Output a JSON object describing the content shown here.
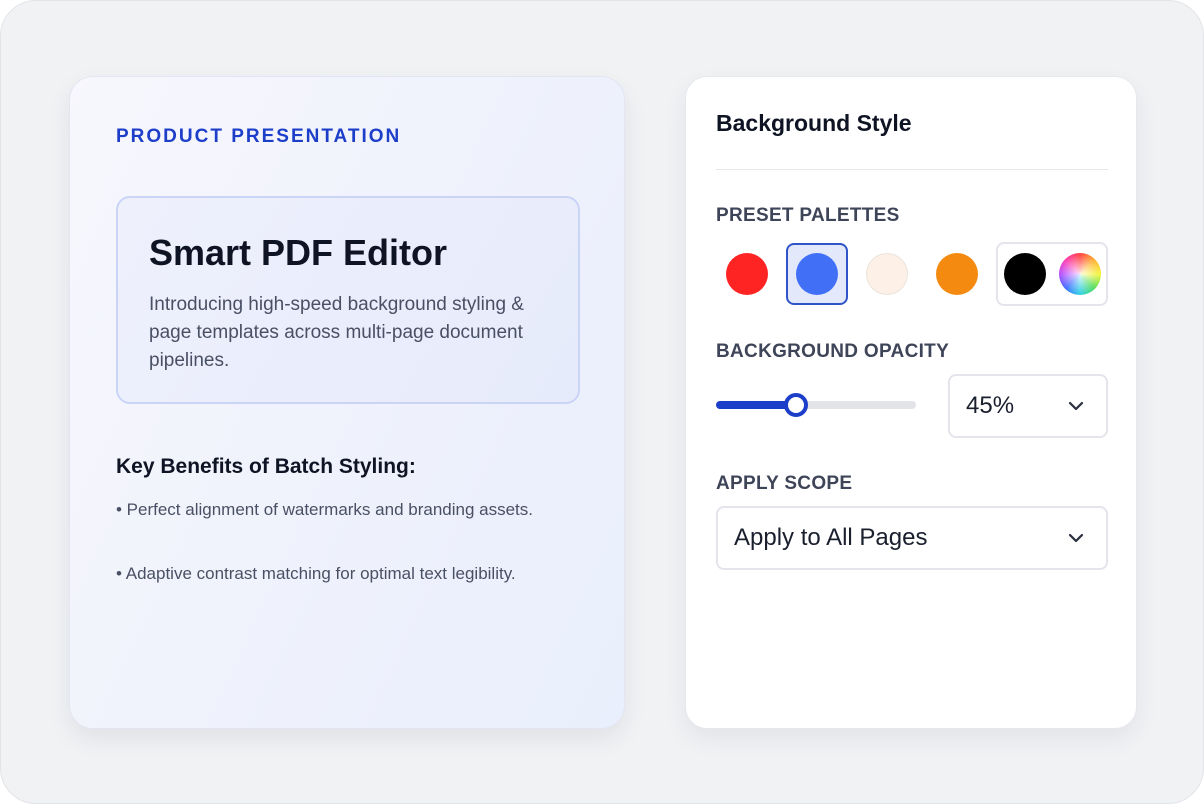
{
  "preview": {
    "eyebrow": "PRODUCT PRESENTATION",
    "hero_title": "Smart PDF Editor",
    "hero_description": "Introducing high-speed background styling & page templates across multi-page document pipelines.",
    "benefits_title": "Key Benefits of Batch Styling:",
    "benefits": [
      "• Perfect alignment of watermarks and branding assets.",
      "• Adaptive contrast matching for optimal text legibility."
    ]
  },
  "panel": {
    "title": "Background Style",
    "palettes": {
      "label": "PRESET PALETTES",
      "swatches": [
        {
          "name": "red",
          "color": "#ff2424",
          "selected": false
        },
        {
          "name": "blue",
          "color": "#4170f7",
          "selected": true
        },
        {
          "name": "cream",
          "color": "#fdf0e6",
          "selected": false
        },
        {
          "name": "orange",
          "color": "#f48a0f",
          "selected": false
        },
        {
          "name": "black",
          "color": "#000000",
          "selected": false
        }
      ],
      "custom_icon": "color-wheel-icon"
    },
    "opacity": {
      "label": "BACKGROUND OPACITY",
      "value_percent": 40,
      "display_value": "45%",
      "accent_color": "#1d3ec9"
    },
    "scope": {
      "label": "APPLY SCOPE",
      "selected": "Apply to All Pages"
    }
  }
}
